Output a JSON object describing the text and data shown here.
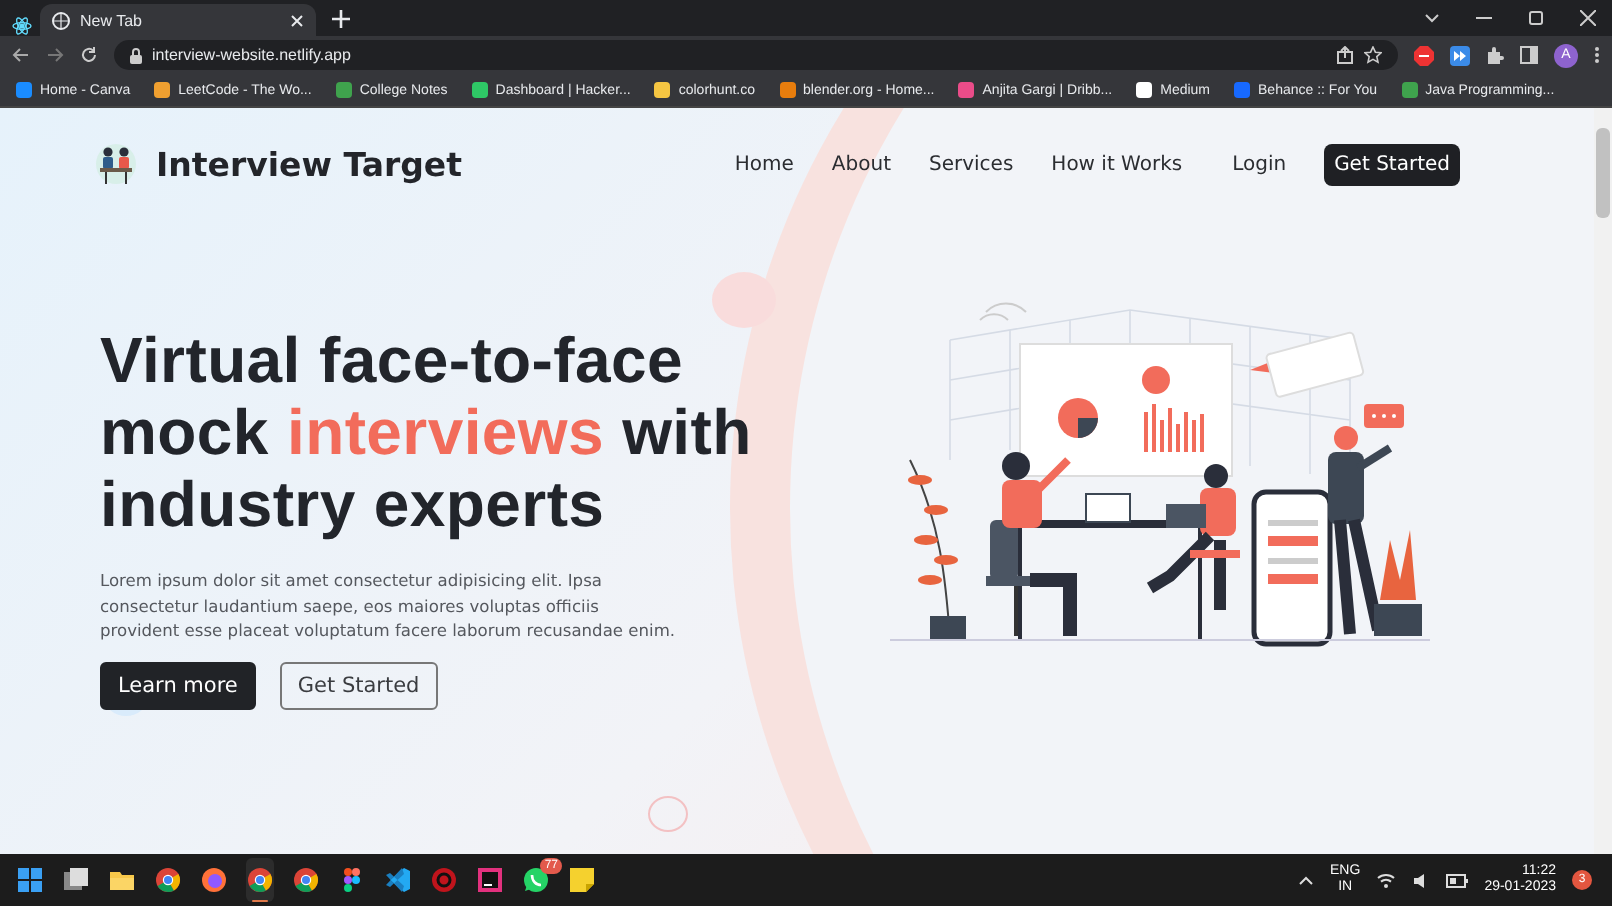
{
  "browser": {
    "tabs": [
      {
        "title": "New Tab",
        "selected": true
      }
    ],
    "url": "interview-website.netlify.app",
    "avatar": "A",
    "bookmarks": [
      {
        "label": "Home - Canva",
        "color": "#1a8cff"
      },
      {
        "label": "LeetCode - The Wo...",
        "color": "#f0a030"
      },
      {
        "label": "College Notes",
        "color": "#3fa34d"
      },
      {
        "label": "Dashboard | Hacker...",
        "color": "#2ec866"
      },
      {
        "label": "colorhunt.co",
        "color": "#f5c542"
      },
      {
        "label": "blender.org - Home...",
        "color": "#e87d0d"
      },
      {
        "label": "Anjita Gargi | Dribb...",
        "color": "#ea4c89"
      },
      {
        "label": "Medium",
        "color": "#ffffff"
      },
      {
        "label": "Behance :: For You",
        "color": "#1769ff"
      },
      {
        "label": "Java Programming...",
        "color": "#3fa34d"
      }
    ]
  },
  "site": {
    "brand": "Interview Target",
    "nav": [
      {
        "label": "Home",
        "kind": "link"
      },
      {
        "label": "About",
        "kind": "link"
      },
      {
        "label": "Services",
        "kind": "link"
      },
      {
        "label": "How it Works",
        "kind": "link"
      },
      {
        "label": "Login",
        "kind": "link"
      },
      {
        "label": "Get Started",
        "kind": "button"
      }
    ],
    "headline": [
      {
        "text": "Virtual face-to-face mock ",
        "highlight": false
      },
      {
        "text": "interviews",
        "highlight": true
      },
      {
        "text": " with industry experts",
        "highlight": false
      }
    ],
    "body": "Lorem ipsum dolor sit amet consectetur adipisicing elit. Ipsa consectetur laudantium saepe, eos maiores voluptas officiis provident esse placeat voluptatum facere laborum recusandae enim.",
    "buttons": [
      {
        "label": "Learn more",
        "kind": "primary"
      },
      {
        "label": "Get Started",
        "kind": "outline"
      }
    ]
  },
  "taskbar": {
    "apps": [
      {
        "kind": "start",
        "active": false
      },
      {
        "kind": "taskview",
        "active": false
      },
      {
        "kind": "folder",
        "active": false
      },
      {
        "kind": "chrome",
        "active": false
      },
      {
        "kind": "firefox",
        "active": false
      },
      {
        "kind": "chrome",
        "active": true
      },
      {
        "kind": "chrome",
        "active": false
      },
      {
        "kind": "figma",
        "active": false
      },
      {
        "kind": "vscode",
        "active": false
      },
      {
        "kind": "record",
        "active": false
      },
      {
        "kind": "jetbrains",
        "active": false
      },
      {
        "kind": "chat",
        "active": false,
        "badge": "77"
      },
      {
        "kind": "notes",
        "active": false
      }
    ],
    "lang": "ENG",
    "region": "IN",
    "time": "11:22",
    "date": "29-01-2023",
    "notifications": "3"
  }
}
